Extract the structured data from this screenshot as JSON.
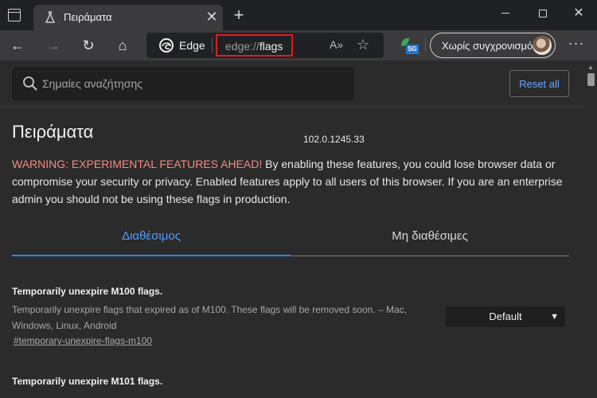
{
  "tab": {
    "title": "Πειράματα",
    "close": "✕"
  },
  "new_tab": "+",
  "window_controls": {
    "minimize": "minimize",
    "maximize": "maximize",
    "close": "✕"
  },
  "toolbar": {
    "back": "←",
    "forward": "→",
    "reload": "↻",
    "home": "⌂",
    "brand": "Edge",
    "url_scheme": "edge://",
    "url_host": "flags",
    "read_aloud": "A»",
    "favorite": "☆",
    "extension_badge": "SG",
    "profile_label": "Χωρίς συγχρονισμό",
    "menu": "···"
  },
  "search": {
    "placeholder": "Σημαίες αναζήτησης"
  },
  "reset_button": "Reset all",
  "page": {
    "title": "Πειράματα",
    "version": "102.0.1245.33",
    "warning_prefix": "WARNING: EXPERIMENTAL FEATURES AHEAD!",
    "warning_text": " By enabling these features, you could lose browser data or compromise your security or privacy. Enabled features apply to all users of this browser. If you are an enterprise admin you should not be using these flags in production."
  },
  "tabs": {
    "available": "Διαθέσιμος",
    "unavailable": "Μη διαθέσιμες"
  },
  "flags": [
    {
      "name": "Temporarily unexpire M100 flags.",
      "description": "Temporarily unexpire flags that expired as of M100. These flags will be removed soon. – Mac, Windows, Linux, Android",
      "link": "#temporary-unexpire-flags-m100",
      "value": "Default"
    },
    {
      "name": "Temporarily unexpire M101 flags."
    }
  ],
  "colors": {
    "accent": "#4f9dff",
    "warning": "#f28b82",
    "highlight_box": "#e0191d"
  }
}
